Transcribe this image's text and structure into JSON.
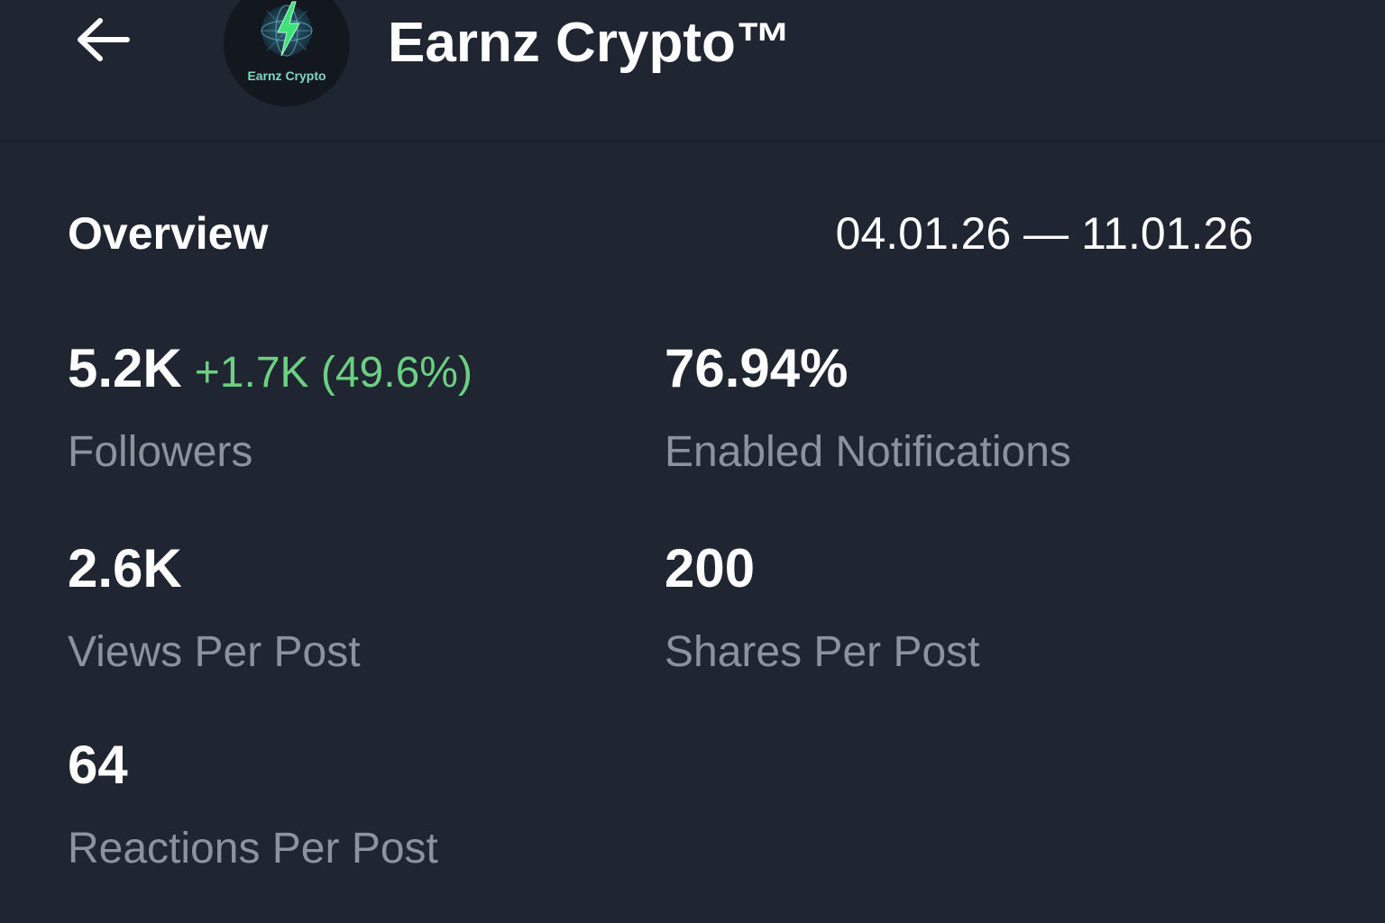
{
  "header": {
    "back_icon": "arrow-left-icon",
    "avatar_text": "Earnz Crypto",
    "avatar_icon": "lightning-bolt-icon",
    "title": "Earnz Crypto™"
  },
  "overview": {
    "title": "Overview",
    "date_range": "04.01.26 — 11.01.26"
  },
  "stats": {
    "followers": {
      "value": "5.2K",
      "change": "+1.7K (49.6%)",
      "label": "Followers"
    },
    "notifications": {
      "value": "76.94%",
      "label": "Enabled Notifications"
    },
    "views": {
      "value": "2.6K",
      "label": "Views Per Post"
    },
    "shares": {
      "value": "200",
      "label": "Shares Per Post"
    },
    "reactions": {
      "value": "64",
      "label": "Reactions Per Post"
    }
  },
  "colors": {
    "background": "#1f2632",
    "text_primary": "#ffffff",
    "text_secondary": "#8b939d",
    "positive": "#6ccf82"
  }
}
